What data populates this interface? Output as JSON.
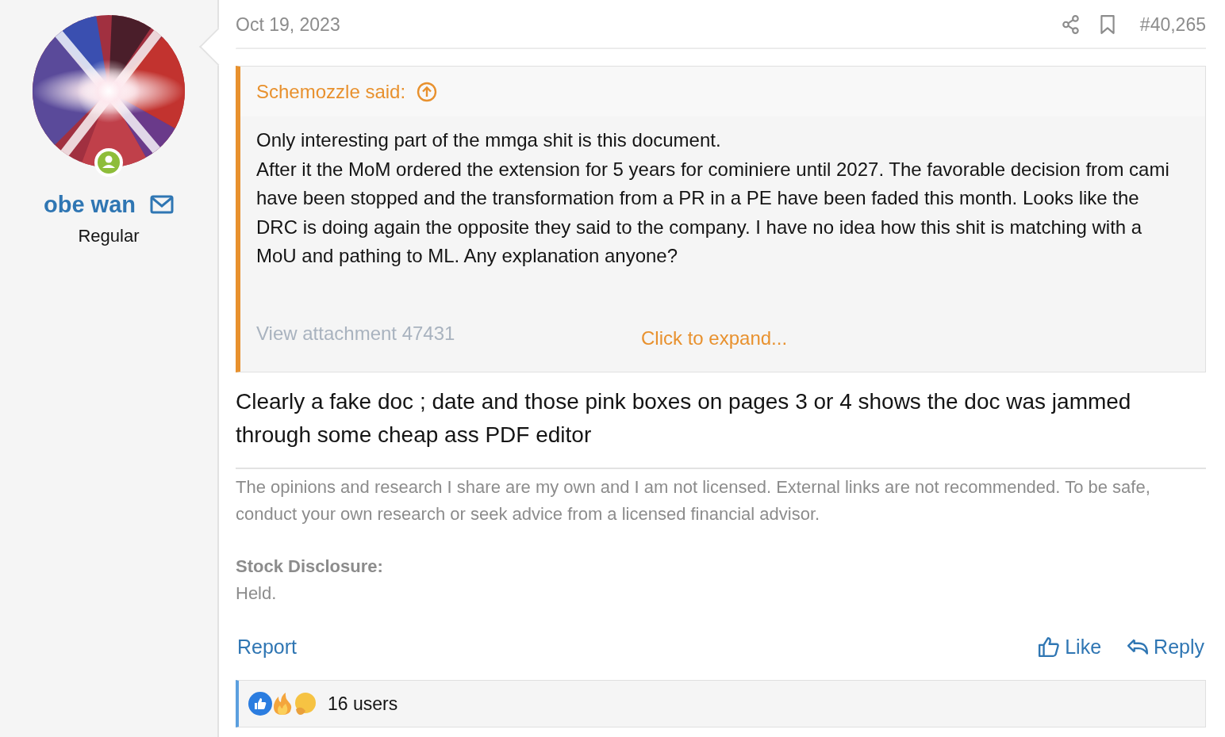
{
  "author": {
    "name": "obe wan",
    "title": "Regular",
    "online": true
  },
  "post": {
    "date": "Oct 19, 2023",
    "number": "#40,265"
  },
  "quote": {
    "author": "Schemozzle said:",
    "lines": [
      "Only interesting part of the mmga shit is this document.",
      "After it the MoM ordered the extension for 5 years for cominiere until 2027. The favorable decision from cami have been stopped and the transformation from a PR in a PE have been faded this month. Looks like the DRC is doing again the opposite they said to the company. I have no idea how this shit is matching with a MoU and pathing to ML. Any explanation anyone?"
    ],
    "attachment": "View attachment 47431",
    "expand": "Click to expand..."
  },
  "body": "Clearly a fake doc ; date and those pink boxes on pages 3 or 4 shows the doc was jammed through some cheap ass PDF editor",
  "signature": {
    "text": "The opinions and research I share are my own and I am not licensed. External links are not recommended. To be safe, conduct your own research or seek advice from a licensed financial advisor.",
    "heading": "Stock Disclosure:",
    "value": "Held."
  },
  "actions": {
    "left": "Report",
    "like": "Like",
    "reply": "Reply"
  },
  "reactions": {
    "icons": [
      {
        "kind": "like"
      },
      {
        "kind": "fire"
      },
      {
        "kind": "thinking"
      }
    ],
    "summary": "16 users"
  }
}
